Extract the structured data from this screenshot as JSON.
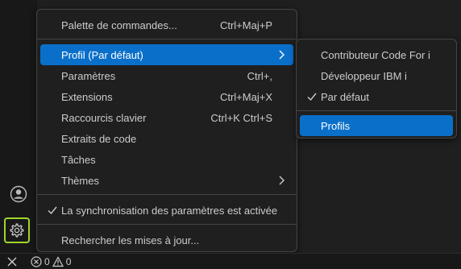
{
  "main_menu": {
    "items": [
      {
        "label": "Palette de commandes...",
        "shortcut": "Ctrl+Maj+P"
      },
      {
        "label": "Profil (Par défaut)",
        "shortcut": ""
      },
      {
        "label": "Paramètres",
        "shortcut": "Ctrl+,"
      },
      {
        "label": "Extensions",
        "shortcut": "Ctrl+Maj+X"
      },
      {
        "label": "Raccourcis clavier",
        "shortcut": "Ctrl+K Ctrl+S"
      },
      {
        "label": "Extraits de code",
        "shortcut": ""
      },
      {
        "label": "Tâches",
        "shortcut": ""
      },
      {
        "label": "Thèmes",
        "shortcut": ""
      },
      {
        "label": "La synchronisation des paramètres est activée",
        "shortcut": ""
      },
      {
        "label": "Rechercher les mises à jour...",
        "shortcut": ""
      }
    ]
  },
  "profile_submenu": {
    "items": [
      {
        "label": "Contributeur Code For i"
      },
      {
        "label": "Développeur IBM i"
      },
      {
        "label": "Par défaut"
      },
      {
        "label": "Profils"
      }
    ]
  },
  "status_bar": {
    "errors": "0",
    "warnings": "0"
  },
  "icons": {
    "account": "account-icon",
    "manage": "gear-icon",
    "remote": "remote-icon",
    "errors": "error-icon",
    "warnings": "warning-icon"
  },
  "colors": {
    "accent": "#0a6fc9",
    "focus_outline": "#9fd62c"
  }
}
